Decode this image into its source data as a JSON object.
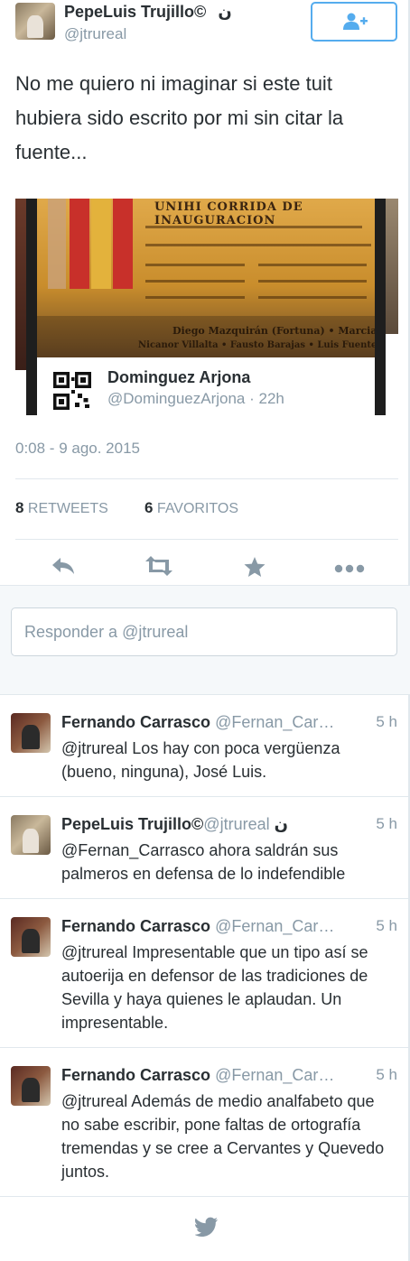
{
  "author": {
    "name": "PepeLuis Trujillo©",
    "name_suffix": "ن",
    "handle": "@jtrureal"
  },
  "follow_button": {
    "icon": "follow-user-icon"
  },
  "tweet": {
    "text": "No me quiero ni imaginar si este tuit hubiera sido escrito por mi sin citar la fuente..."
  },
  "embedded_tweet": {
    "name": "Dominguez Arjona",
    "handle_time": "@DominguezArjona · 22h",
    "poster_caption": "UNIHI CORRIDA DE INAUGURACION",
    "poster_names_1": "Diego Mazquirán (Fortuna) • Marcial Lalanda",
    "poster_names_2": "Nicanor Villalta • Fausto Barajas • Luis Fuentes Bejarano"
  },
  "timestamp": "0:08 - 9 ago. 2015",
  "stats": {
    "retweets_count": "8",
    "retweets_label": "RETWEETS",
    "favorites_count": "6",
    "favorites_label": "FAVORITOS"
  },
  "actions": [
    "reply-icon",
    "retweet-icon",
    "favorite-star-icon",
    "more-icon"
  ],
  "reply_box": {
    "placeholder": "Responder a @jtrureal"
  },
  "replies": [
    {
      "name": "Fernando Carrasco",
      "handle": "@Fernan_Car…",
      "time": "5 h",
      "text": "@jtrureal Los hay con poca vergüenza (bueno, ninguna), José Luis."
    },
    {
      "name": "PepeLuis Trujillo©",
      "handle": "@jtrureal",
      "suffix": "ن",
      "time": "5 h",
      "text": "@Fernan_Carrasco ahora saldrán sus palmeros en defensa de lo indefendible"
    },
    {
      "name": "Fernando Carrasco",
      "handle": "@Fernan_Car…",
      "time": "5 h",
      "text": "@jtrureal Impresentable que un tipo así se autoerija en defensor de las tradiciones de Sevilla y haya quienes le aplaudan. Un impresentable."
    },
    {
      "name": "Fernando Carrasco",
      "handle": "@Fernan_Car…",
      "time": "5 h",
      "text": "@jtrureal Además de medio analfabeto que no sabe escribir, pone faltas de ortografía tremendas y se cree a Cervantes y Quevedo juntos."
    }
  ],
  "colors": {
    "accent": "#55acee",
    "text": "#292f33",
    "muted": "#8899a6",
    "icon": "#8899a6"
  },
  "footer_icon": "twitter-bird-icon"
}
